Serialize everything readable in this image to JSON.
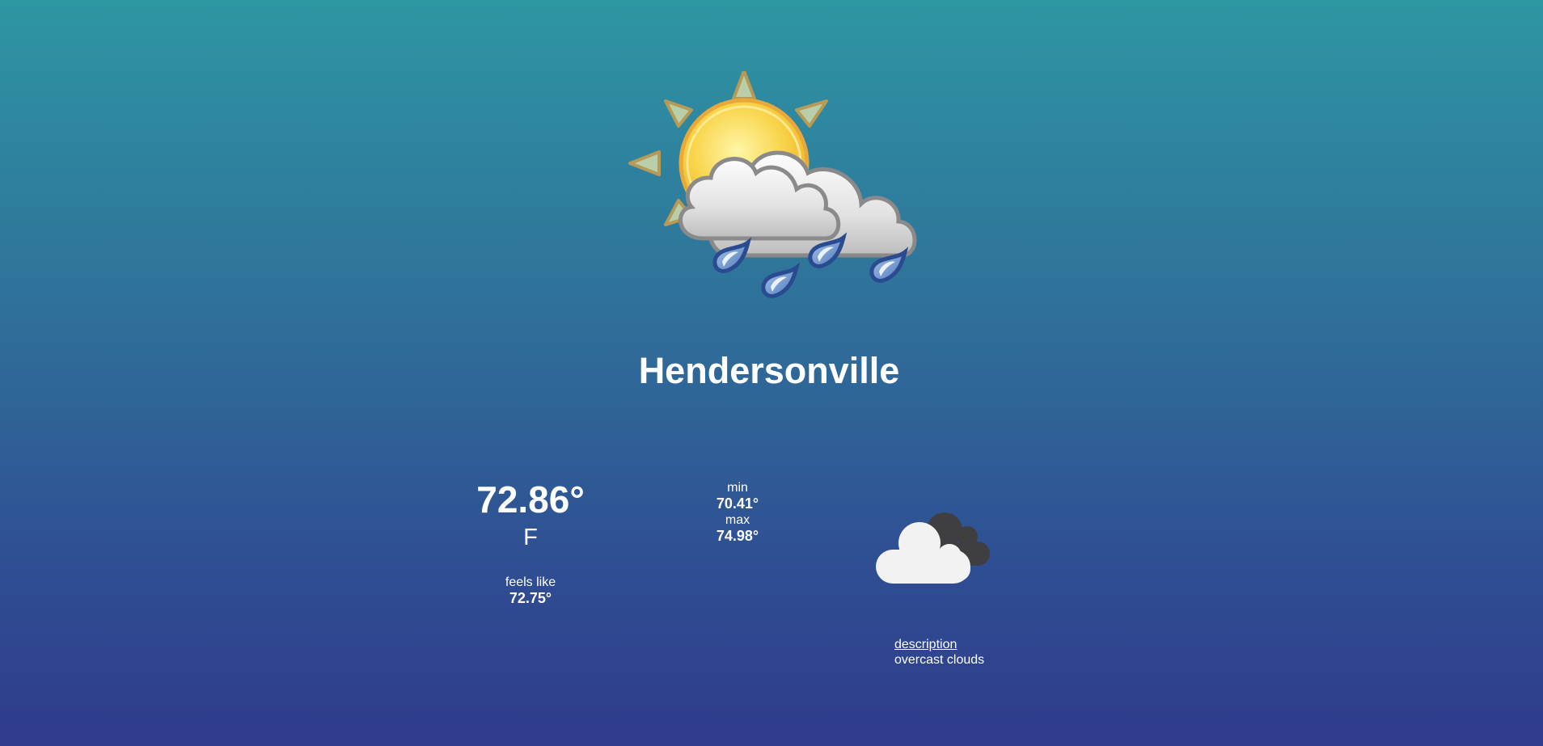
{
  "weather": {
    "city": "Hendersonville",
    "hero_icon": "sun-cloud-rain-icon",
    "temperature": "72.86°",
    "unit": "F",
    "feels_like_label": "feels like",
    "feels_like_value": "72.75°",
    "min_label": "min",
    "min_value": "70.41°",
    "max_label": "max",
    "max_value": "74.98°",
    "condition_icon": "overcast-clouds-icon",
    "description_label": "description",
    "description_value": "overcast clouds"
  },
  "colors": {
    "background_top": "#2e96a3",
    "background_bottom": "#2f3b8b",
    "text": "#ffffff"
  }
}
